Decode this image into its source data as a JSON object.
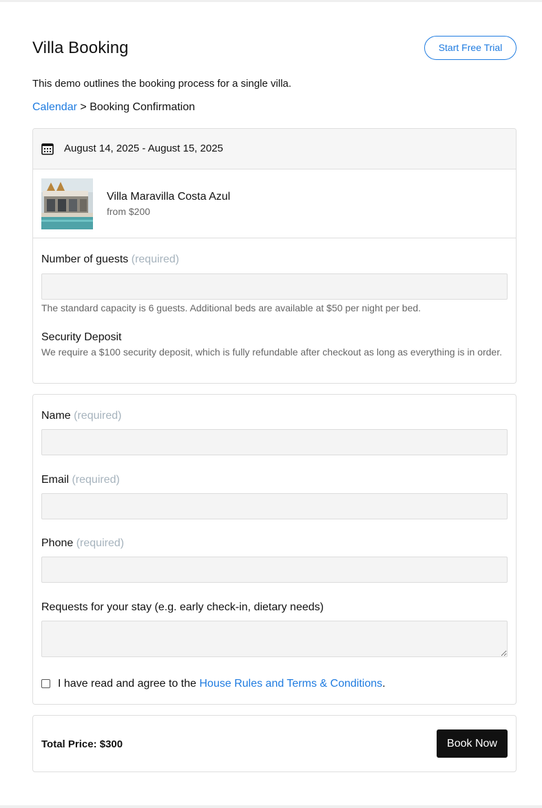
{
  "header": {
    "title": "Villa Booking",
    "trial_button": "Start Free Trial"
  },
  "intro": "This demo outlines the booking process for a single villa.",
  "breadcrumb": {
    "link": "Calendar",
    "separator": ">",
    "current": "Booking Confirmation"
  },
  "booking": {
    "dates": "August 14, 2025 - August 15, 2025",
    "villa_name": "Villa Maravilla Costa Azul",
    "villa_price": "from $200",
    "guests_label": "Number of guests",
    "required_tag": "(required)",
    "guests_hint": "The standard capacity is 6 guests. Additional beds are available at $50 per night per bed.",
    "deposit_title": "Security Deposit",
    "deposit_text": "We require a $100 security deposit, which is fully refundable after checkout as long as everything is in order."
  },
  "contact": {
    "name_label": "Name",
    "email_label": "Email",
    "phone_label": "Phone",
    "requests_label": "Requests for your stay (e.g. early check-in, dietary needs)",
    "required_tag": "(required)",
    "agree_prefix": "I have read and agree to the",
    "agree_link": "House Rules and Terms & Conditions",
    "agree_suffix": "."
  },
  "summary": {
    "total": "Total Price: $300",
    "book_button": "Book Now"
  },
  "colors": {
    "accent": "#1e7be0",
    "button_dark": "#111111",
    "required": "#a6b3bd"
  },
  "icons": {
    "date": "calendar-icon",
    "villa": "villa-photo"
  }
}
